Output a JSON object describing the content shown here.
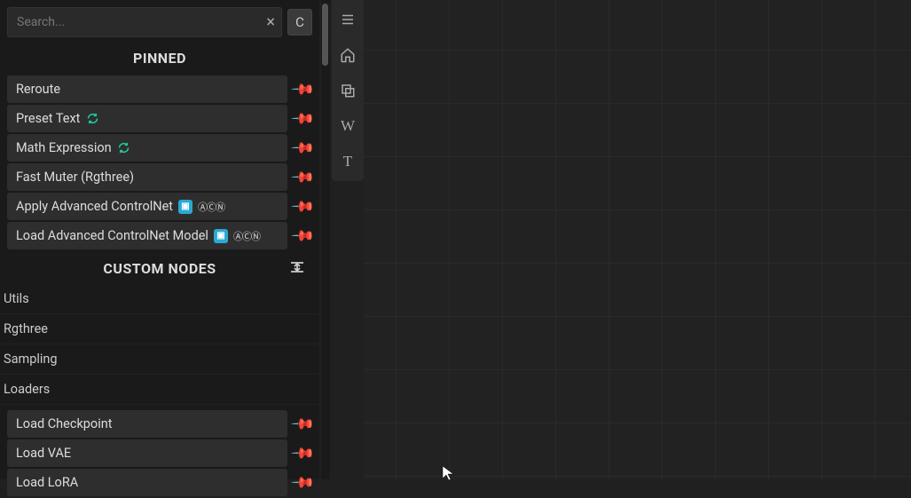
{
  "search": {
    "placeholder": "Search...",
    "clear": "×",
    "c_label": "C"
  },
  "sections": {
    "pinned": "PINNED",
    "custom": "CUSTOM NODES"
  },
  "pinned": [
    {
      "label": "Reroute",
      "badges": []
    },
    {
      "label": "Preset Text",
      "badges": [
        "green"
      ]
    },
    {
      "label": "Math Expression",
      "badges": [
        "green"
      ]
    },
    {
      "label": "Fast Muter (Rgthree)",
      "badges": []
    },
    {
      "label": "Apply Advanced ControlNet",
      "badges": [
        "blue",
        "circles"
      ]
    },
    {
      "label": "Load Advanced ControlNet Model",
      "badges": [
        "blue",
        "circles"
      ]
    }
  ],
  "custom": [
    "Utils",
    "Rgthree",
    "Sampling",
    "Loaders"
  ],
  "loaders": [
    "Load Checkpoint",
    "Load VAE",
    "Load LoRA"
  ],
  "toolbar": {
    "menu": "hamburger-icon",
    "home": "home-icon",
    "copy": "copy-icon",
    "w": "W",
    "t": "T"
  }
}
